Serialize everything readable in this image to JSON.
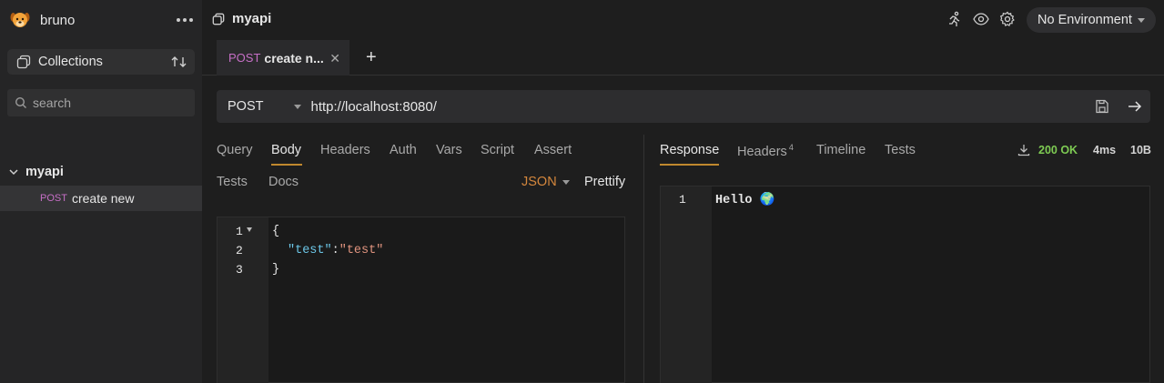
{
  "app": {
    "name": "bruno"
  },
  "sidebar": {
    "collections_label": "Collections",
    "search_placeholder": "search",
    "collection": {
      "name": "myapi"
    },
    "request": {
      "method": "POST",
      "name": "create new"
    }
  },
  "topbar": {
    "title": "myapi",
    "environment": "No Environment"
  },
  "tab": {
    "method": "POST",
    "name": "create n..."
  },
  "request": {
    "method": "POST",
    "url": "http://localhost:8080/"
  },
  "request_tabs": [
    "Query",
    "Body",
    "Headers",
    "Auth",
    "Vars",
    "Script",
    "Assert",
    "Tests",
    "Docs"
  ],
  "body": {
    "mode": "JSON",
    "prettify": "Prettify",
    "lines": [
      {
        "no": "1",
        "text": "{"
      },
      {
        "no": "2",
        "key": "\"test\"",
        "sep": ":",
        "value": "\"test\""
      },
      {
        "no": "3",
        "text": "}"
      }
    ]
  },
  "response_tabs": {
    "response": "Response",
    "headers": "Headers",
    "headers_count": "4",
    "timeline": "Timeline",
    "tests": "Tests"
  },
  "response": {
    "status": "200 OK",
    "time": "4ms",
    "size": "10B",
    "line_no": "1",
    "body": "Hello 🌍"
  },
  "colors": {
    "accent": "#c0882e",
    "method_post": "#c66fc6",
    "status_ok": "#7ecb53",
    "json_mode": "#d4873d"
  }
}
